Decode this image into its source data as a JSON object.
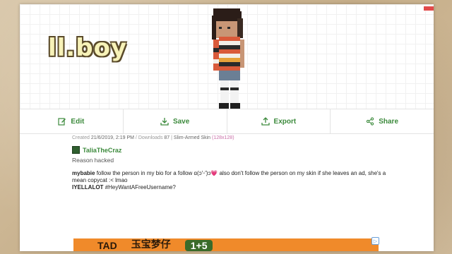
{
  "skin": {
    "name": "ll.boy"
  },
  "toolbar": {
    "edit": "Edit",
    "save": "Save",
    "export": "Export",
    "share": "Share"
  },
  "meta": {
    "created_label": "Created",
    "created_value": "21/6/2019, 2:19 PM",
    "downloads_label": "Downloads",
    "downloads_value": "87",
    "model": "Slim-Armed",
    "type": "Skin",
    "resolution": "(128x128)"
  },
  "author": {
    "name": "TaliaTheCraz",
    "reason": "Reason hacked"
  },
  "comments": [
    {
      "user": "mybabie",
      "text": "follow the person in my bio for a follow ɑ(ɔ'ᵕ')ɔ💗 also don't follow the person on my skin if she leaves an ad, she's a mean copycat :< lmao"
    },
    {
      "user": "IYELLALOT",
      "text": "#HeyWantAFreeUsername?"
    }
  ],
  "ad": {
    "text1": "TAD",
    "text2": "玉宝梦仔",
    "badge": "1+5"
  },
  "colors": {
    "accent": "#3c8a3c",
    "highlight": "#c96fa8",
    "ad": "#f08a2a"
  }
}
